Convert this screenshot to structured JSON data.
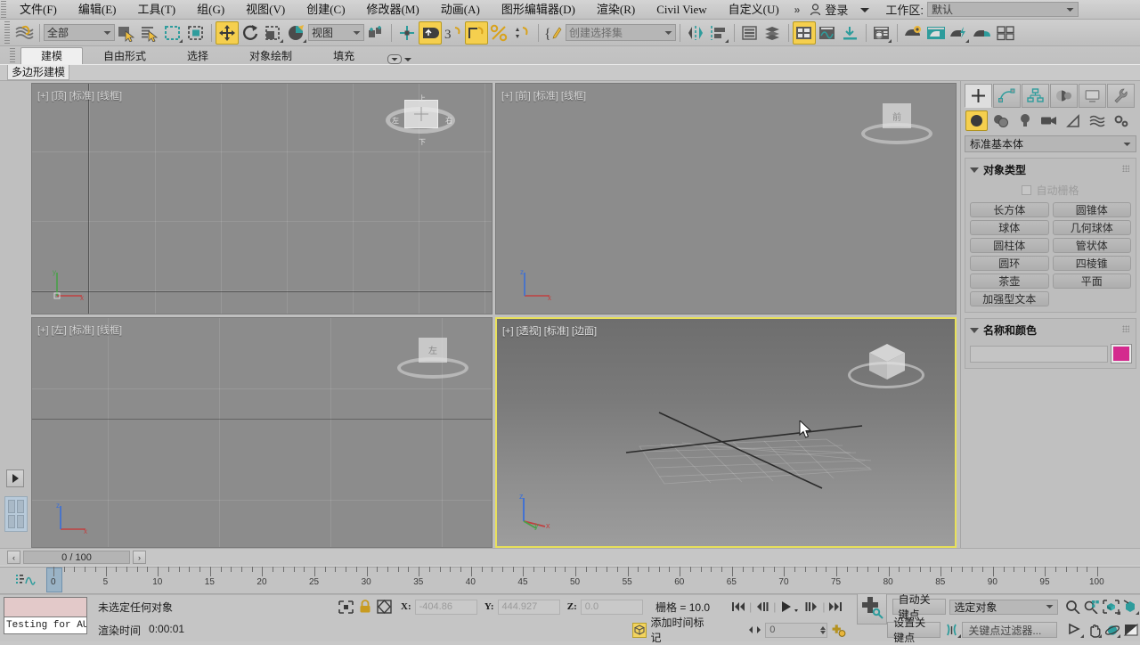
{
  "menu": {
    "items": [
      "文件(F)",
      "编辑(E)",
      "工具(T)",
      "组(G)",
      "视图(V)",
      "创建(C)",
      "修改器(M)",
      "动画(A)",
      "图形编辑器(D)",
      "渲染(R)",
      "Civil View",
      "自定义(U)"
    ],
    "overflow": "»",
    "login_label": "登录",
    "workspace_label": "工作区:",
    "workspace_value": "默认"
  },
  "toolbar": {
    "selection_filter": "全部",
    "reference_coord": "视图",
    "named_sets": "创建选择集",
    "icons": [
      "undo-redo-link-icon",
      "select-object-icon",
      "select-by-name-icon",
      "rect-selection-region-icon",
      "window-crossing-icon",
      "select-and-move-icon",
      "select-and-rotate-icon",
      "select-and-scale-icon",
      "select-and-place-icon",
      "use-center-flyout-icon",
      "select-and-link-icon",
      "unlink-selection-icon",
      "bind-to-space-warp-icon",
      "snaps-toggle-icon",
      "angle-snap-icon",
      "percent-snap-icon",
      "spinner-snap-icon",
      "edit-named-selection-icon",
      "mirror-icon",
      "align-icon",
      "layer-manager-icon",
      "scene-explorer-icon",
      "curve-editor-icon",
      "schematic-view-icon",
      "material-editor-icon",
      "render-setup-icon",
      "rendered-frame-window-icon",
      "render-production-icon",
      "render-iterative-icon",
      "active-shade-icon",
      "render-preview-icon"
    ]
  },
  "ribbon": {
    "tabs": [
      "建模",
      "自由形式",
      "选择",
      "对象绘制",
      "填充"
    ],
    "selected_tab": "建模",
    "sub_chip": "多边形建模"
  },
  "viewports": [
    {
      "name": "viewport-top",
      "label": "[+] [顶] [标准] [线框]",
      "selected": false
    },
    {
      "name": "viewport-front",
      "label": "[+] [前] [标准] [线框]",
      "selected": false,
      "cube_text": "前"
    },
    {
      "name": "viewport-left",
      "label": "[+] [左] [标准] [线框]",
      "selected": false,
      "cube_text": "左"
    },
    {
      "name": "viewport-perspective",
      "label": "[+] [透视] [标准] [边面]",
      "selected": true
    }
  ],
  "viewcube": {
    "top": "上",
    "bottom": "下",
    "left": "左",
    "right": "右",
    "face": "上"
  },
  "command_panel": {
    "tabs": [
      "create-tab",
      "modify-tab",
      "hierarchy-tab",
      "motion-tab",
      "display-tab",
      "utilities-tab"
    ],
    "selected_tab_index": 0,
    "categories": [
      "geometry-icon",
      "shapes-icon",
      "lights-icon",
      "cameras-icon",
      "helpers-icon",
      "space-warps-icon",
      "systems-icon"
    ],
    "selected_category_index": 0,
    "subcategory": "标准基本体",
    "object_type": {
      "title": "对象类型",
      "autogrid_label": "自动栅格",
      "autogrid_checked": false,
      "buttons": [
        "长方体",
        "圆锥体",
        "球体",
        "几何球体",
        "圆柱体",
        "管状体",
        "圆环",
        "四棱锥",
        "茶壶",
        "平面",
        "加强型文本"
      ]
    },
    "name_and_color": {
      "title": "名称和颜色",
      "name_value": "",
      "color_hex": "#d42a8e"
    }
  },
  "timebar": {
    "prev_label": "‹",
    "next_label": "›",
    "frame_field": "0 / 100",
    "ruler_labels": [
      "0",
      "5",
      "10",
      "15",
      "20",
      "25",
      "30",
      "35",
      "40",
      "45",
      "50",
      "55",
      "60",
      "65",
      "70",
      "75",
      "80",
      "85",
      "90",
      "95",
      "100"
    ],
    "current_frame": 0
  },
  "statusbar": {
    "listener_text": "Testing for AU",
    "prompt": "未选定任何对象",
    "render_time_label": "渲染时间",
    "render_time_value": "0:00:01",
    "coords": {
      "x_label": "X:",
      "x": "-404.86",
      "y_label": "Y:",
      "y": "444.927",
      "z_label": "Z:",
      "z": "0.0"
    },
    "grid_text": "栅格 = 10.0",
    "add_time_tag": "添加时间标记",
    "frame_spinner": "0",
    "auto_key": "自动关键点",
    "set_key": "设置关键点",
    "key_filters": "关键点过滤器...",
    "selection_set": "选定对象",
    "nav_icons": [
      "zoom-icon",
      "zoom-all-icon",
      "zoom-extents-icon",
      "zoom-region-icon",
      "pan-icon",
      "orbit-icon",
      "maximize-viewport-icon",
      "field-of-view-icon"
    ]
  },
  "colors": {
    "accent_yellow": "#f5cf4e",
    "teal": "#2e9c9c",
    "selected_viewport_border": "#e8e05a"
  }
}
